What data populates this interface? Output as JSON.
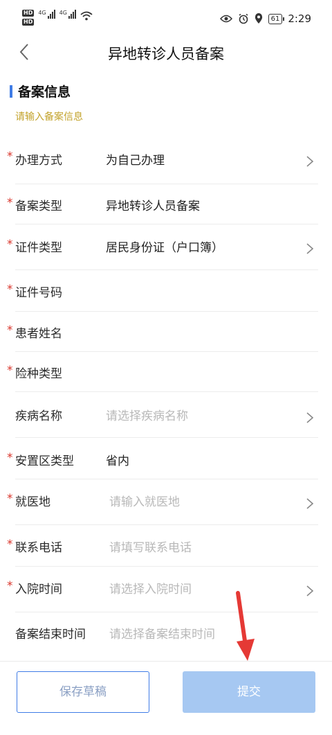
{
  "status_bar": {
    "hd1": "HD",
    "hd2": "HD",
    "sim1": "4G",
    "sim2": "4G",
    "battery": "61",
    "time": "2:29"
  },
  "header": {
    "title": "异地转诊人员备案"
  },
  "section": {
    "title": "备案信息",
    "hint": "请输入备案信息"
  },
  "form": {
    "rows": [
      {
        "label": "办理方式",
        "value": "为自己办理",
        "placeholder": ""
      },
      {
        "label": "备案类型",
        "value": "异地转诊人员备案",
        "placeholder": ""
      },
      {
        "label": "证件类型",
        "value": "居民身份证（户口簿）",
        "placeholder": ""
      },
      {
        "label": "证件号码",
        "value": "",
        "placeholder": ""
      },
      {
        "label": "患者姓名",
        "value": "",
        "placeholder": ""
      },
      {
        "label": "险种类型",
        "value": "",
        "placeholder": ""
      },
      {
        "label": "疾病名称",
        "value": "",
        "placeholder": "请选择疾病名称"
      },
      {
        "label": "安置区类型",
        "value": "省内",
        "placeholder": ""
      },
      {
        "label": "就医地",
        "value": "",
        "placeholder": "请输入就医地"
      },
      {
        "label": "联系电话",
        "value": "",
        "placeholder": "请填写联系电话"
      },
      {
        "label": "入院时间",
        "value": "",
        "placeholder": "请选择入院时间"
      },
      {
        "label": "备案结束时间",
        "value": "",
        "placeholder": "请选择备案结束时间"
      }
    ],
    "required_mark": "*"
  },
  "actions": {
    "draft": "保存草稿",
    "submit": "提交"
  },
  "colors": {
    "accent": "#3f7ce6",
    "required": "#d9362c",
    "hint": "#c3a32c",
    "submit_bg": "#a6c8f2",
    "annotation_arrow": "#e53935"
  }
}
